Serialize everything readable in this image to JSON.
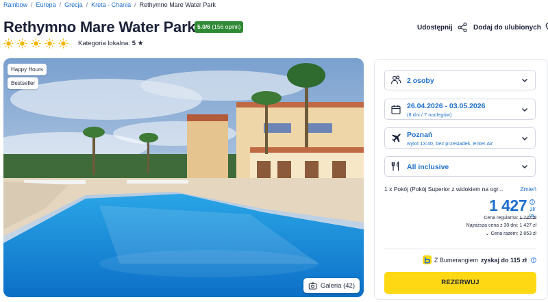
{
  "breadcrumb": {
    "items": [
      "Rainbow",
      "Europa",
      "Grecja",
      "Kreta - Chania"
    ],
    "current": "Rethymno Mare Water Park"
  },
  "hotel": {
    "name": "Rethymno Mare Water Park",
    "rating_score": "5.0/6",
    "rating_count": "(156 opinii)",
    "category_label": "Kategoria lokalna:",
    "category_value": "5",
    "category_star": "★",
    "stars": 5
  },
  "actions": {
    "share_label": "Udostępnij",
    "favorite_label": "Dodaj do ulubionych"
  },
  "photo": {
    "badges": [
      "Happy Hours",
      "Bestseller"
    ],
    "gallery_label": "Galeria (42)"
  },
  "booking": {
    "persons": "2 osoby",
    "dates": "26.04.2026 - 03.05.2026",
    "dates_sub": "(8 dni / 7 noclegów)",
    "departure": "Poznań",
    "departure_sub": "wylot 13:40, bez przesiadek, Enter Air",
    "board": "All inclusive",
    "room": "1 x Pokój  (Pokój Superior z widokiem na ogr...",
    "room_change": "Zmień",
    "price": "1 427",
    "price_unit_1": "zł/",
    "price_unit_2": "os.",
    "regular_price_label": "Cena regularna:",
    "regular_price_value": "1 727 zł",
    "lowest_price": "Najniższa cena z 30 dni: 1 427 zł",
    "total_price": "Cena razem: 2 853 zł",
    "boomerang_prefix": "Z Bumerangiem",
    "boomerang_value": "zyskaj do 115 zł",
    "reserve_label": "REZERWUJ"
  },
  "colors": {
    "link_blue": "#1d6fcf",
    "rating_green": "#2e8a34",
    "sun_yellow": "#f7b500",
    "reserve_yellow": "#ffd814",
    "text_dark": "#1c2239"
  }
}
